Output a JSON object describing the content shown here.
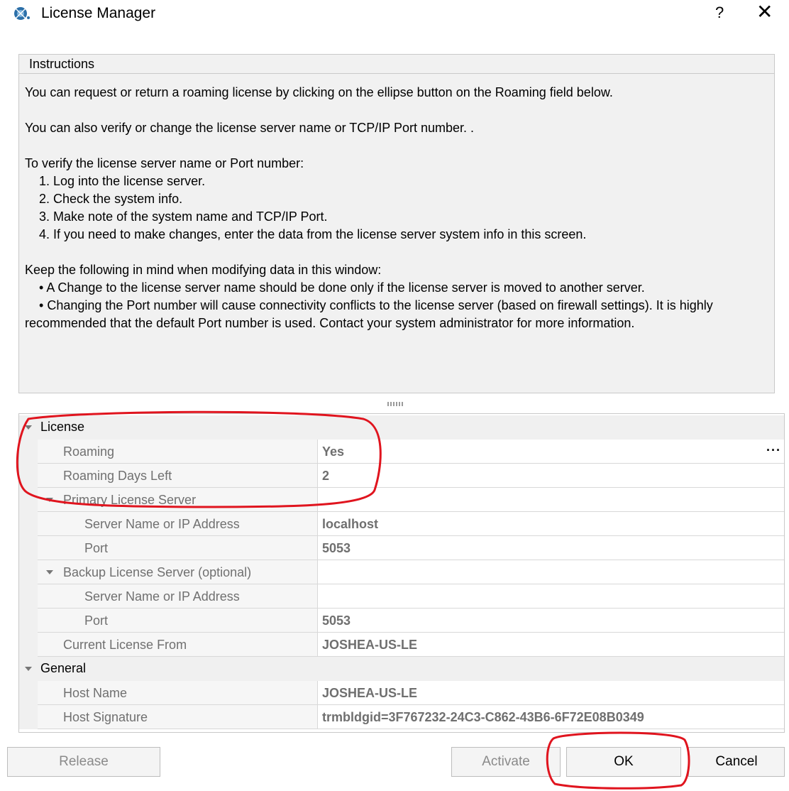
{
  "window": {
    "title": "License Manager",
    "help_label": "?",
    "close_label": "✕"
  },
  "instructions": {
    "header": "Instructions",
    "body": "You can request or return a roaming license by clicking on the ellipse button on the Roaming field below.\n\nYou can also verify or change the license server name or TCP/IP Port number. .\n\nTo verify the license server name or Port number:\n    1. Log into the license server.\n    2. Check the system info.\n    3. Make note of the system name and TCP/IP Port.\n    4. If you need to make changes, enter the data from the license server system info in this screen.\n\nKeep the following in mind when modifying data in this window:\n    • A Change to the license server name should be done only if the license server is moved to another server.\n    • Changing the Port number will cause connectivity conflicts to the license server (based on firewall settings). It is highly recommended that the default Port number is used. Contact your system administrator for more information."
  },
  "grid": {
    "license_category": "License",
    "roaming": {
      "name": "Roaming",
      "value": "Yes",
      "ellipsis": "···"
    },
    "roaming_days_left": {
      "name": "Roaming Days Left",
      "value": "2"
    },
    "primary_server": "Primary License Server",
    "primary_server_name": {
      "name": "Server Name or IP Address",
      "value": "localhost"
    },
    "primary_port": {
      "name": "Port",
      "value": "5053"
    },
    "backup_server": "Backup License Server (optional)",
    "backup_server_name": {
      "name": "Server Name or IP Address",
      "value": ""
    },
    "backup_port": {
      "name": "Port",
      "value": "5053"
    },
    "current_license_from": {
      "name": "Current License From",
      "value": "JOSHEA-US-LE"
    },
    "general_category": "General",
    "host_name": {
      "name": "Host Name",
      "value": "JOSHEA-US-LE"
    },
    "host_signature": {
      "name": "Host Signature",
      "value": "trmbldgid=3F767232-24C3-C862-43B6-6F72E08B0349"
    }
  },
  "buttons": {
    "release": "Release",
    "activate": "Activate",
    "ok": "OK",
    "cancel": "Cancel"
  },
  "colors": {
    "annotation": "#e0141e",
    "gutter": "#f0f0f0",
    "value_text": "#6f6f6f"
  }
}
